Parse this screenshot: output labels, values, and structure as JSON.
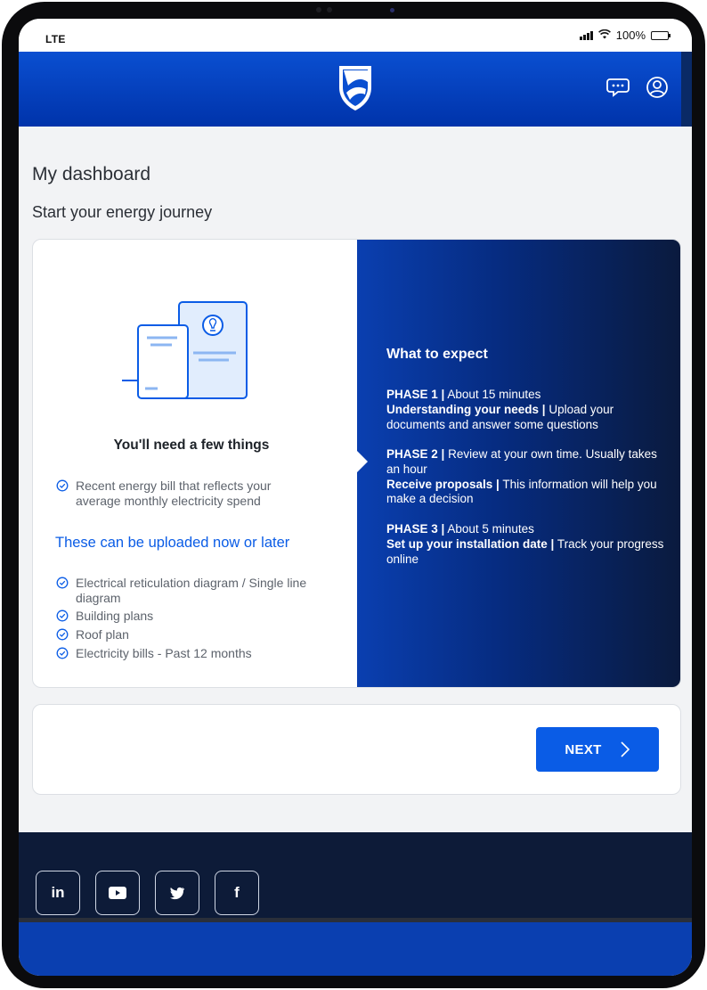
{
  "status_bar": {
    "carrier": "LTE",
    "battery": "100%"
  },
  "header": {
    "logo": "shield-logo",
    "chat_icon": "chat-bubble-icon",
    "profile_icon": "user-profile-icon"
  },
  "page": {
    "title": "My dashboard",
    "subtitle": "Start your energy journey"
  },
  "requirements": {
    "heading": "You'll need a few things",
    "required_items": [
      "Recent energy bill that reflects your average monthly electricity spend"
    ],
    "optional_heading": "These can be uploaded now or later",
    "optional_items": [
      "Electrical reticulation diagram / Single line diagram",
      "Building plans",
      "Roof plan",
      "Electricity bills - Past 12 months"
    ]
  },
  "expectations": {
    "heading": "What to expect",
    "phases": [
      {
        "label": "PHASE 1 |",
        "duration": "About 15 minutes",
        "title": "Understanding your needs |",
        "description": "Upload your documents and answer some questions"
      },
      {
        "label": "PHASE 2 |",
        "duration": "Review at your own time. Usually takes an hour",
        "title": "Receive proposals |",
        "description": "This information will help you make a decision"
      },
      {
        "label": "PHASE 3 |",
        "duration": "About 5 minutes",
        "title": "Set up your installation date |",
        "description": "Track your progress online"
      }
    ]
  },
  "actions": {
    "next_label": "NEXT"
  },
  "footer": {
    "social": [
      {
        "label": "in",
        "icon": "linkedin-icon"
      },
      {
        "label": "▶",
        "icon": "youtube-icon"
      },
      {
        "label": "twitter",
        "icon": "twitter-icon"
      },
      {
        "label": "f",
        "icon": "facebook-icon"
      }
    ]
  },
  "colors": {
    "brand_blue": "#0a5ce6",
    "header_blue": "#0033aa",
    "footer_navy": "#0d1b38"
  }
}
